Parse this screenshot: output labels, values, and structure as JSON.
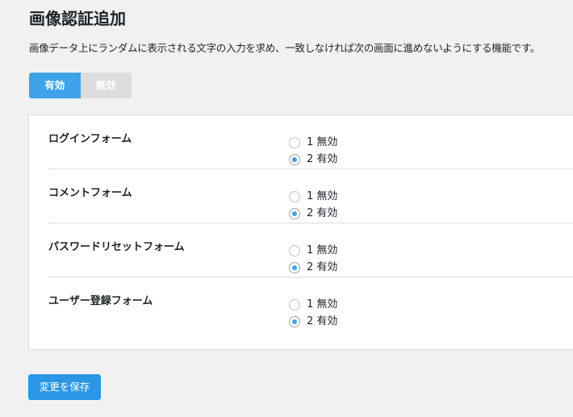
{
  "page": {
    "title": "画像認証追加",
    "description": "画像データ上にランダムに表示される文字の入力を求め、一致しなければ次の画面に進めないようにする機能です。"
  },
  "toggle": {
    "enabled_label": "有効",
    "disabled_label": "無効",
    "selected": "enabled"
  },
  "settings": {
    "rows": [
      {
        "label": "ログインフォーム",
        "options": [
          {
            "label": "1 無効",
            "checked": false
          },
          {
            "label": "2 有効",
            "checked": true
          }
        ]
      },
      {
        "label": "コメントフォーム",
        "options": [
          {
            "label": "1 無効",
            "checked": false
          },
          {
            "label": "2 有効",
            "checked": true
          }
        ]
      },
      {
        "label": "パスワードリセットフォーム",
        "options": [
          {
            "label": "1 無効",
            "checked": false
          },
          {
            "label": "2 有効",
            "checked": true
          }
        ]
      },
      {
        "label": "ユーザー登録フォーム",
        "options": [
          {
            "label": "1 無効",
            "checked": false
          },
          {
            "label": "2 有効",
            "checked": true
          }
        ]
      }
    ]
  },
  "actions": {
    "save_label": "変更を保存"
  },
  "colors": {
    "accent": "#3ea3e8",
    "button": "#2b96e5",
    "background": "#f1f1f1",
    "toggle_inactive": "#dcdcde"
  }
}
